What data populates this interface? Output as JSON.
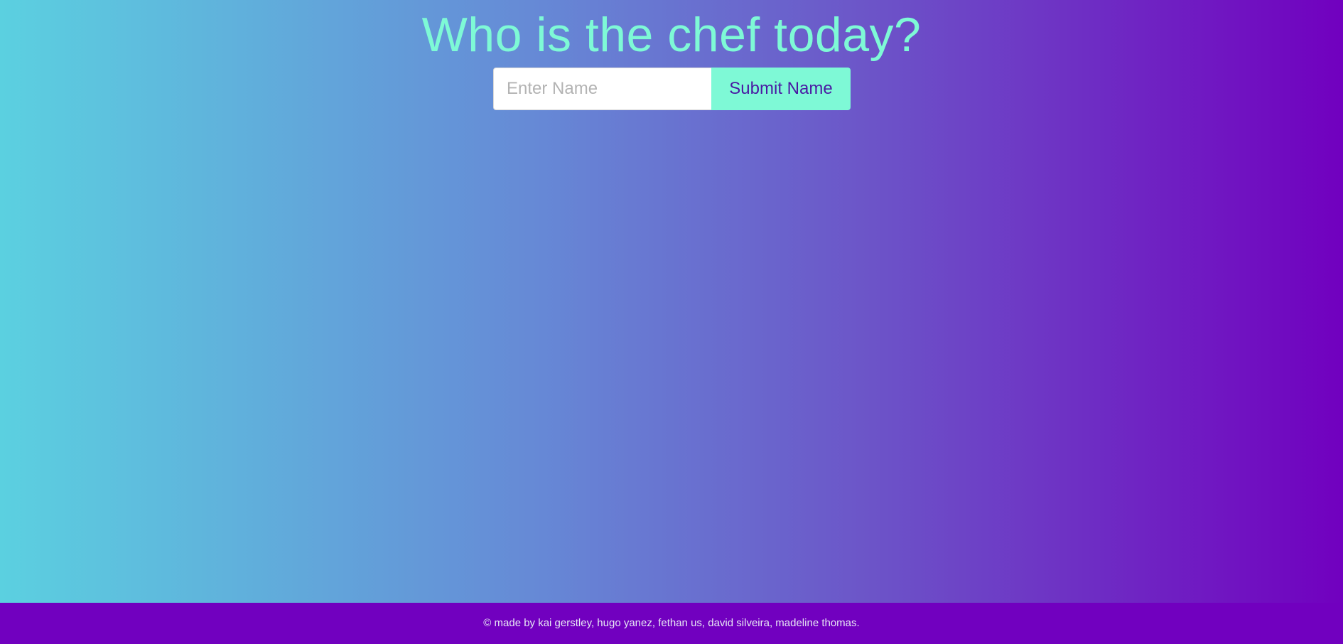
{
  "header": {
    "title": "Who is the chef today?"
  },
  "form": {
    "name_placeholder": "Enter Name",
    "name_value": "",
    "submit_label": "Submit Name"
  },
  "footer": {
    "credits": "© made by kai gerstley, hugo yanez, fethan us, david silveira, madeline thomas."
  },
  "colors": {
    "gradient_start": "#5bd0e0",
    "gradient_end": "#7100bf",
    "accent": "#7ef9d6",
    "button_text": "#4a1aa3",
    "footer_background": "#7100bf"
  }
}
